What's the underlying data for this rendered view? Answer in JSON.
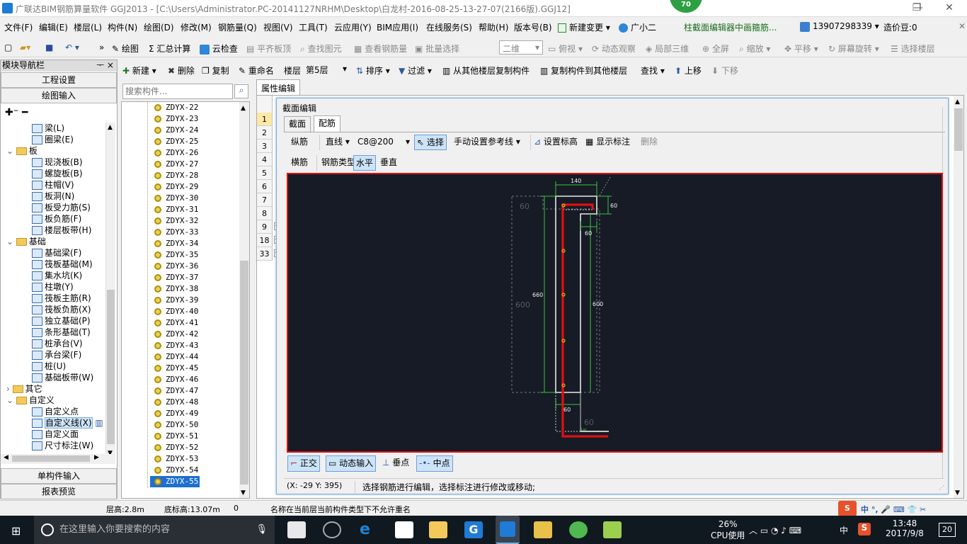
{
  "title_bar": {
    "title": "广联达BIM钢筋算量软件 GGJ2013 - [C:\\Users\\Administrator.PC-20141127NRHM\\Desktop\\白龙村-2016-08-25-13-27-07(2166版).GGJ12]",
    "score_badge": "70",
    "minimize": "—",
    "restore": "❐",
    "close": "✕"
  },
  "menu": {
    "items": [
      "文件(F)",
      "编辑(E)",
      "楼层(L)",
      "构件(N)",
      "绘图(D)",
      "修改(M)",
      "钢筋量(Q)",
      "视图(V)",
      "工具(T)",
      "云应用(Y)",
      "BIM应用(I)",
      "在线服务(S)",
      "帮助(H)",
      "版本号(B)",
      "新建变更 ▾",
      "广小二"
    ],
    "notice": "柱截面编辑器中画箍筋...",
    "phone": "13907298339 ▾",
    "price": "造价豆:0"
  },
  "toolbar1": {
    "draw": "绘图",
    "sum": "汇总计算",
    "cloud_check": "云检查",
    "flush_slab": "平齐板顶",
    "find_element": "查找图元",
    "view_rebar": "查看钢筋量",
    "batch_select": "批量选择",
    "view_mode": "二维",
    "top_view": "俯视 ▾",
    "dynamic_view": "动态观察",
    "local_3d": "局部三维",
    "fullscreen": "全屏",
    "zoom": "缩放 ▾",
    "pan": "平移 ▾",
    "rotate": "屏幕旋转 ▾",
    "select_floor": "选择楼层"
  },
  "toolbar2": {
    "new": "新建 ▾",
    "delete": "删除",
    "copy": "复制",
    "rename": "重命名",
    "floor_label": "楼层",
    "floor_value": "第5层",
    "sort": "排序 ▾",
    "filter": "过滤 ▾",
    "copy_from": "从其他楼层复制构件",
    "copy_to": "复制构件到其他楼层",
    "find": "查找 ▾",
    "move_up": "上移",
    "move_down": "下移"
  },
  "nav": {
    "header": "模块导航栏",
    "pin": "ᅮ ×",
    "project_settings": "工程设置",
    "drawing_input": "绘图输入",
    "single_input": "单构件输入",
    "report_preview": "报表预览",
    "tree": [
      {
        "label": "梁(L)",
        "level": 2
      },
      {
        "label": "圈梁(E)",
        "level": 2
      },
      {
        "label": "板",
        "level": 1,
        "folder": true
      },
      {
        "label": "现浇板(B)",
        "level": 2
      },
      {
        "label": "螺旋板(B)",
        "level": 2
      },
      {
        "label": "柱帽(V)",
        "level": 2
      },
      {
        "label": "板洞(N)",
        "level": 2
      },
      {
        "label": "板受力筋(S)",
        "level": 2
      },
      {
        "label": "板负筋(F)",
        "level": 2
      },
      {
        "label": "楼层板带(H)",
        "level": 2
      },
      {
        "label": "基础",
        "level": 1,
        "folder": true
      },
      {
        "label": "基础梁(F)",
        "level": 2
      },
      {
        "label": "筏板基础(M)",
        "level": 2
      },
      {
        "label": "集水坑(K)",
        "level": 2
      },
      {
        "label": "柱墩(Y)",
        "level": 2
      },
      {
        "label": "筏板主筋(R)",
        "level": 2
      },
      {
        "label": "筏板负筋(X)",
        "level": 2
      },
      {
        "label": "独立基础(P)",
        "level": 2
      },
      {
        "label": "条形基础(T)",
        "level": 2
      },
      {
        "label": "桩承台(V)",
        "level": 2
      },
      {
        "label": "承台梁(F)",
        "level": 2
      },
      {
        "label": "桩(U)",
        "level": 2
      },
      {
        "label": "基础板带(W)",
        "level": 2
      },
      {
        "label": "其它",
        "level": 1,
        "folder": true,
        "collapsed": true
      },
      {
        "label": "自定义",
        "level": 1,
        "folder": true
      },
      {
        "label": "自定义点",
        "level": 2
      },
      {
        "label": "自定义线(X)",
        "level": 2,
        "selected": true
      },
      {
        "label": "自定义面",
        "level": 2
      },
      {
        "label": "尺寸标注(W)",
        "level": 2
      }
    ]
  },
  "component_list": {
    "search_placeholder": "搜索构件...",
    "items": [
      "ZDYX-22",
      "ZDYX-23",
      "ZDYX-24",
      "ZDYX-25",
      "ZDYX-26",
      "ZDYX-27",
      "ZDYX-28",
      "ZDYX-29",
      "ZDYX-30",
      "ZDYX-31",
      "ZDYX-32",
      "ZDYX-33",
      "ZDYX-34",
      "ZDYX-35",
      "ZDYX-36",
      "ZDYX-37",
      "ZDYX-38",
      "ZDYX-39",
      "ZDYX-40",
      "ZDYX-41",
      "ZDYX-42",
      "ZDYX-43",
      "ZDYX-44",
      "ZDYX-45",
      "ZDYX-46",
      "ZDYX-47",
      "ZDYX-48",
      "ZDYX-49",
      "ZDYX-50",
      "ZDYX-51",
      "ZDYX-52",
      "ZDYX-53",
      "ZDYX-54",
      "ZDYX-55"
    ],
    "selected": "ZDYX-55"
  },
  "property_panel": {
    "title": "属性编辑",
    "row_numbers": [
      "1",
      "2",
      "3",
      "4",
      "5",
      "6",
      "7",
      "8",
      "9",
      "18",
      "33"
    ]
  },
  "section_editor": {
    "title": "截面编辑",
    "tabs": [
      "截面",
      "配筋"
    ],
    "active_tab": "配筋",
    "toolbar": {
      "longitudinal": "纵筋",
      "line_type": "直线",
      "rebar_spec": "C8@200",
      "select": "选择",
      "manual_ref": "手动设置参考线 ▾",
      "set_elevation": "设置标高",
      "show_annotation": "显示标注",
      "delete": "删除",
      "transverse": "横筋",
      "rebar_type": "钢筋类型:",
      "horizontal": "水平",
      "vertical": "垂直"
    },
    "drawing": {
      "dims": [
        "140",
        "60",
        "60",
        "660",
        "600",
        "600",
        "60",
        "60",
        "60"
      ],
      "small_note": "1ac"
    },
    "bottom_tools": {
      "ortho": "正交",
      "dynamic_input": "动态输入",
      "perpendicular": "垂点",
      "midpoint": "中点"
    },
    "coords": "(X: -29 Y: 395)",
    "hint": "选择钢筋进行编辑，选择标注进行修改或移动;"
  },
  "status_bar": {
    "floor_height": "层高:2.8m",
    "bottom_elev": "底标高:13.07m",
    "value": "0",
    "message": "名称在当前层当前构件类型下不允许重名"
  },
  "taskbar": {
    "search_placeholder": "在这里输入你要搜索的内容",
    "cpu_percent": "26%",
    "cpu_label": "CPU使用",
    "ime": "中",
    "time": "13:48",
    "date": "2017/9/8",
    "notifications": "20"
  },
  "colors": {
    "canvas_bg": "#161b26",
    "rebar_red": "#e01010",
    "dim_green": "#3ec13e",
    "score_green": "#2ea043",
    "taskbar": "#101820"
  }
}
